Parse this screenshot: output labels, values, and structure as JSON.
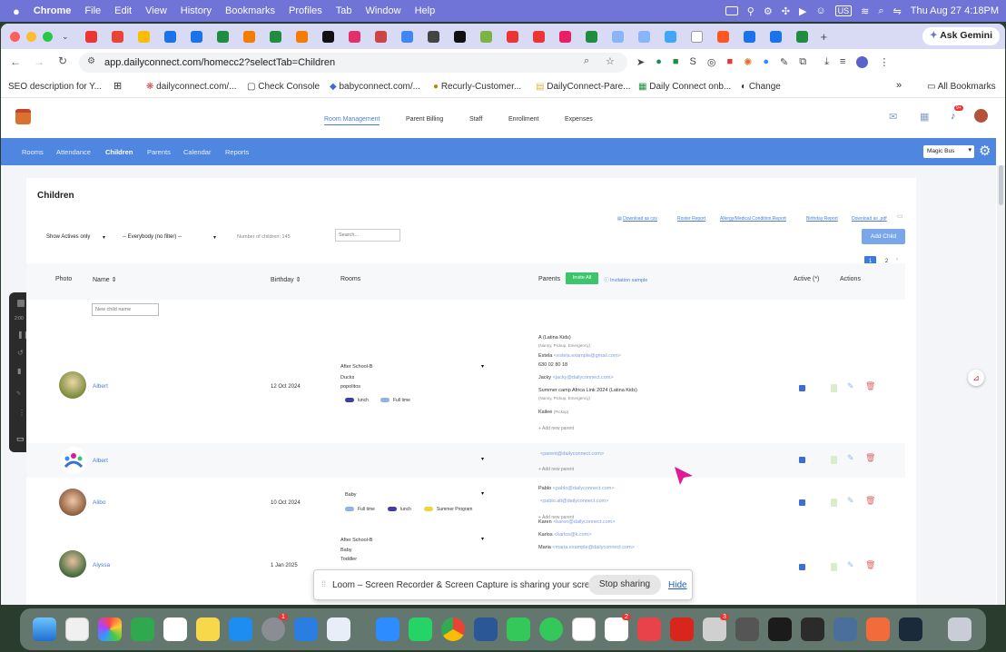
{
  "menubar": {
    "items": [
      "Chrome",
      "File",
      "Edit",
      "View",
      "History",
      "Bookmarks",
      "Profiles",
      "Tab",
      "Window",
      "Help"
    ],
    "status": {
      "input_source": "US",
      "datetime": "Thu Aug 27  4:18PM"
    }
  },
  "browser": {
    "url": "app.dailyconnect.com/homecc2?selectTab=Children",
    "ask_gemini": "Ask Gemini",
    "bookmarks": [
      "SEO description for Y...",
      "dailyconnect.com/...",
      "Check Console",
      "babyconnect.com/...",
      "Recurly-Customer...",
      "DailyConnect-Pare...",
      "Daily Connect onb...",
      "Change"
    ],
    "all_bookmarks": "All Bookmarks"
  },
  "app": {
    "topnav": [
      "Room Management",
      "Parent Billing",
      "Staff",
      "Enrollment",
      "Expenses"
    ],
    "subnav": [
      "Rooms",
      "Attendance",
      "Children",
      "Parents",
      "Calendar",
      "Reports"
    ],
    "room_select": "Magic Bus",
    "notification_count": "9+"
  },
  "children_page": {
    "title": "Children",
    "filter_active": "Show Actives only",
    "filter_everybody": "-- Everybody (no filter) --",
    "count_label": "Number of children: 145",
    "search_placeholder": "Search...",
    "report_links": [
      "Download as csv",
      "Roster Report",
      "Allergy/Medical Condition Report",
      "Birthday Report",
      "Download as .pdf"
    ],
    "add_child": "Add Child",
    "pages": [
      "1",
      "2"
    ],
    "headers": {
      "photo": "Photo",
      "name": "Name",
      "birthday": "Birthday",
      "rooms": "Rooms",
      "parents": "Parents",
      "invite_all": "Invite All",
      "invitation_sample": "Invitation sample",
      "active": "Active (*)",
      "actions": "Actions"
    },
    "new_child_placeholder": "New child name",
    "add_new_parent": "Add new parent",
    "rows": [
      {
        "name": "Albert",
        "birthday": "12 Oct 2024",
        "rooms": [
          "After School-B",
          "Ducks",
          "popolitos"
        ],
        "programs": [
          "lunch",
          "Full time"
        ],
        "parents": {
          "p1": "A (Latina Kids)",
          "p1_role": "(Nanny, Pickup, Emergency)",
          "p2": "Estela",
          "p2_email": "<estela.example@gmail.com>",
          "p2_phone": "630 02 80 18",
          "p3": "Jacky",
          "p3_email": "<jacky@dailyconnect.com>",
          "p4": "Summer camp Africa Link 2024 (Latina Kids)",
          "p4_role": "(Nanny, Pickup, Emergency)",
          "p5": "Kailee",
          "p5_role": "(Pickup)"
        }
      },
      {
        "name": "Albert",
        "birthday": "",
        "parent_email": "<parent@dailyconnect.com>"
      },
      {
        "name": "Alibo",
        "birthday": "10 Oct 2024",
        "rooms": [
          "Baby"
        ],
        "programs": [
          "Full time",
          "lunch",
          "Summer Program"
        ],
        "parents": {
          "p1": "Pablo",
          "p1_email": "<pablo@dailyconnect.com>",
          "p2_email": "<pablo.alt@dailyconnect.com>"
        }
      },
      {
        "name": "Alyssa",
        "birthday": "1 Jan 2025",
        "rooms": [
          "After School-B",
          "Baby",
          "Toddler"
        ],
        "parents": {
          "p1": "Karen",
          "p1_email": "<karen@dailyconnect.com>",
          "p2": "Karlos",
          "p2_email": "<karlos@k.com>",
          "p3": "Maria",
          "p3_email": "<maria.example@dailyconnect.com>"
        }
      }
    ]
  },
  "loom_banner": {
    "message": "Loom – Screen Recorder & Screen Capture is sharing your screen.",
    "stop": "Stop sharing",
    "hide": "Hide"
  },
  "dock_badges": {
    "settings": "1",
    "slack": "2",
    "printer": "3"
  },
  "colors": {
    "menubar": "#6f74d6",
    "subnav": "#4e86e0",
    "invite_green": "#3cc56b",
    "link_blue": "#4a7fd4",
    "cursor_magenta": "#e0189a"
  }
}
